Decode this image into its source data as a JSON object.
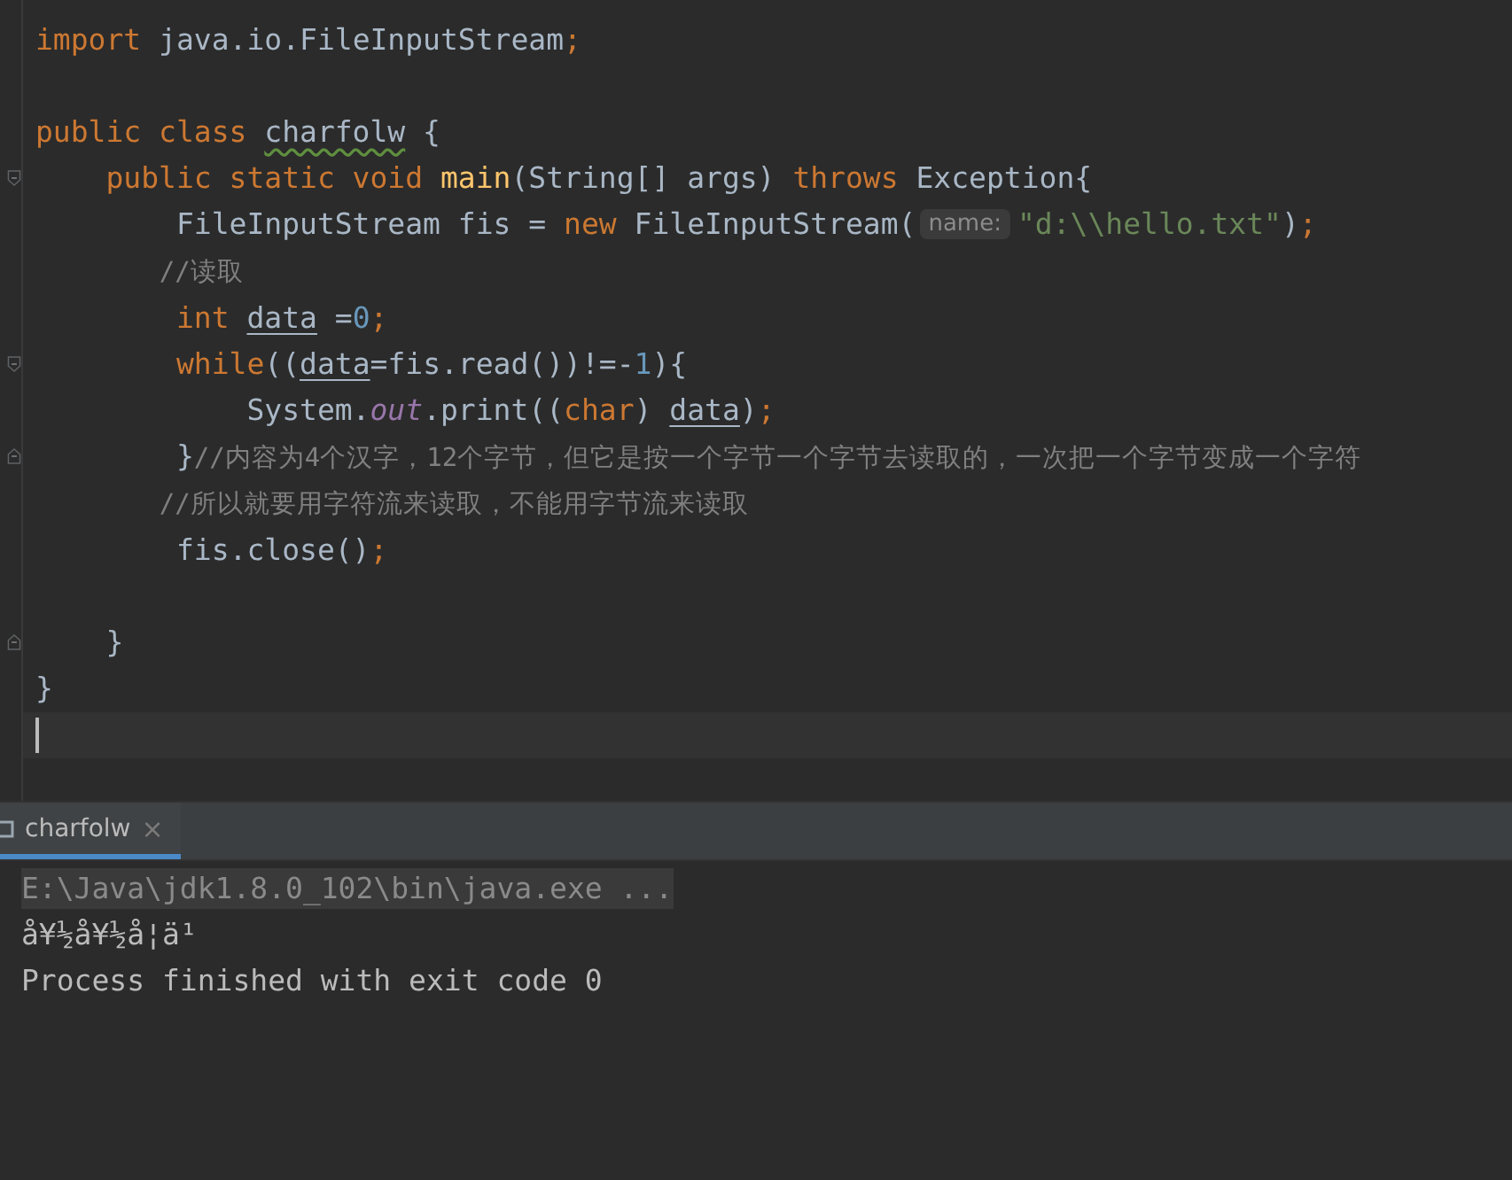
{
  "editor": {
    "lines": [
      {
        "current": false,
        "tokens": [
          {
            "kind": "keyword",
            "text": "import "
          },
          {
            "kind": "plain",
            "text": "java.io.FileInputStream"
          },
          {
            "kind": "keyword",
            "text": ";"
          }
        ]
      },
      {
        "current": false
      },
      {
        "current": false,
        "tokens": [
          {
            "kind": "keyword",
            "text": "public class "
          },
          {
            "kind": "warning",
            "text": "charfolw"
          },
          {
            "kind": "plain",
            "text": " {"
          }
        ]
      },
      {
        "current": false,
        "fold": {
          "kind": "start"
        },
        "tokens": [
          {
            "kind": "keyword",
            "text": "    public static void "
          },
          {
            "kind": "declaration",
            "text": "main"
          },
          {
            "kind": "plain",
            "text": "(String[] args) "
          },
          {
            "kind": "keyword",
            "text": "throws "
          },
          {
            "kind": "plain",
            "text": "Exception{"
          }
        ]
      },
      {
        "current": false,
        "tokens": [
          {
            "kind": "plain",
            "text": "        FileInputStream fis = "
          },
          {
            "kind": "keyword",
            "text": "new "
          },
          {
            "kind": "plain",
            "text": "FileInputStream("
          },
          {
            "kind": "hint",
            "text": "name:"
          },
          {
            "kind": "string",
            "text": "\"d:\\\\hello.txt\""
          },
          {
            "kind": "plain",
            "text": ")"
          },
          {
            "kind": "keyword",
            "text": ";"
          }
        ]
      },
      {
        "current": false,
        "tokens": [
          {
            "kind": "comment",
            "text": "        //读取"
          }
        ]
      },
      {
        "current": false,
        "tokens": [
          {
            "kind": "keyword",
            "text": "        int "
          },
          {
            "kind": "variable",
            "text": "data"
          },
          {
            "kind": "plain",
            "text": " ="
          },
          {
            "kind": "number",
            "text": "0"
          },
          {
            "kind": "keyword",
            "text": ";"
          }
        ]
      },
      {
        "current": false,
        "fold": {
          "kind": "start"
        },
        "tokens": [
          {
            "kind": "keyword",
            "text": "        while"
          },
          {
            "kind": "plain",
            "text": "(("
          },
          {
            "kind": "variable",
            "text": "data"
          },
          {
            "kind": "plain",
            "text": "=fis.read())!=-"
          },
          {
            "kind": "number",
            "text": "1"
          },
          {
            "kind": "plain",
            "text": "){"
          }
        ]
      },
      {
        "current": false,
        "tokens": [
          {
            "kind": "plain",
            "text": "            System."
          },
          {
            "kind": "static",
            "text": "out"
          },
          {
            "kind": "plain",
            "text": ".print(("
          },
          {
            "kind": "keyword",
            "text": "char"
          },
          {
            "kind": "plain",
            "text": ") "
          },
          {
            "kind": "variable",
            "text": "data"
          },
          {
            "kind": "plain",
            "text": ")"
          },
          {
            "kind": "keyword",
            "text": ";"
          }
        ]
      },
      {
        "current": false,
        "fold": {
          "kind": "end"
        },
        "tokens": [
          {
            "kind": "plain",
            "text": "        }"
          },
          {
            "kind": "comment",
            "text": "//内容为4个汉字，12个字节，但它是按一个字节一个字节去读取的，一次把一个字节变成一个字符"
          }
        ]
      },
      {
        "current": false,
        "tokens": [
          {
            "kind": "comment",
            "text": "        //所以就要用字符流来读取，不能用字节流来读取"
          }
        ]
      },
      {
        "current": false,
        "tokens": [
          {
            "kind": "plain",
            "text": "        fis.close()"
          },
          {
            "kind": "keyword",
            "text": ";"
          }
        ]
      },
      {
        "current": false
      },
      {
        "current": false,
        "fold": {
          "kind": "end"
        },
        "tokens": [
          {
            "kind": "plain",
            "text": "    }"
          }
        ]
      },
      {
        "current": false,
        "tokens": [
          {
            "kind": "plain",
            "text": "}"
          }
        ]
      },
      {
        "current": true
      }
    ]
  },
  "run_panel": {
    "tabs": [
      {
        "label": "charfolw",
        "close": "×",
        "selected": true
      }
    ],
    "console": [
      {
        "kind": "command",
        "text": "E:\\Java\\jdk1.8.0_102\\bin\\java.exe ..."
      },
      {
        "kind": "output",
        "text": "å¥½å¥½å­¦ä¹"
      },
      {
        "kind": "output",
        "text": "Process finished with exit code 0"
      }
    ]
  }
}
